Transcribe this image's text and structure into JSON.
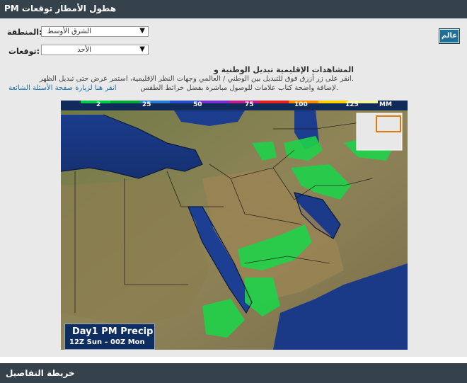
{
  "header": {
    "title": "PM هطول الأمطار توقعات"
  },
  "form": {
    "region_label": ":المنطقة",
    "region_value": "الشرق الأوسط",
    "forecast_label": ":توقعات",
    "forecast_value": "الأحد"
  },
  "world_button": {
    "label": "عالم"
  },
  "description": {
    "title": "المشاهدات الإقليمية تبديل الوطنية و",
    "line1": ".انقر على زر أزرق فوق للتبديل بين الوطني / العالمي وجهات النظر الإقليمية، استمر عرض حتى تبديل الظهر",
    "line2": ".لإضافة واضحة كتاب علامات للوصول مباشرة بفضل خرائط الطقس",
    "link": "انقر هنا لزيارة صفحة الأسئلة الشائعة"
  },
  "map": {
    "scale_labels": [
      "2",
      "25",
      "50",
      "75",
      "100",
      "125",
      "MM"
    ],
    "scale_colors": [
      "#00c94a",
      "#00a83a",
      "#2b7bd1",
      "#2a4fcc",
      "#7a2ecc",
      "#c21e8a",
      "#e02222",
      "#ff8a00",
      "#ffd200",
      "#f5f5a0"
    ],
    "legend_title": "Day1 PM Precip",
    "legend_subtitle": "12Z Sun – 00Z Mon",
    "colors": {
      "sea": "#1b3a8a",
      "land": "#7a7a42",
      "desert": "#a88f5c",
      "precip": "#1fd24a"
    }
  },
  "footer": {
    "title": "خريطة التفاصيل"
  }
}
